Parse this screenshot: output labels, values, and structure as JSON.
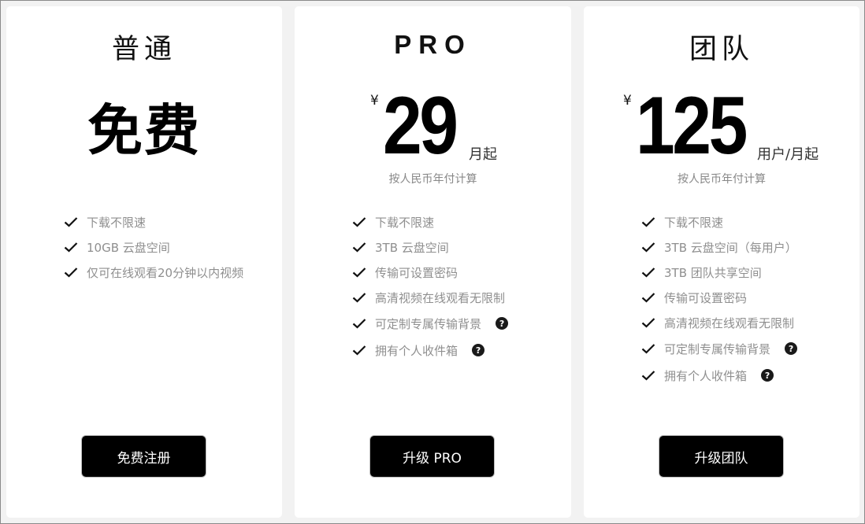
{
  "plans": [
    {
      "name": "普通",
      "price_text": "免费",
      "features": [
        "下载不限速",
        "10GB 云盘空间",
        "仅可在线观看20分钟以内视频"
      ],
      "cta_label": "免费注册"
    },
    {
      "name": "PRO",
      "currency": "¥",
      "amount": "29",
      "unit": "月起",
      "billing_note": "按人民币年付计算",
      "features": [
        "下载不限速",
        "3TB 云盘空间",
        "传输可设置密码",
        "高清视频在线观看无限制",
        "可定制专属传输背景",
        "拥有个人收件箱"
      ],
      "cta_label": "升级 PRO"
    },
    {
      "name": "团队",
      "currency": "¥",
      "amount": "125",
      "unit": "用户/月起",
      "billing_note": "按人民币年付计算",
      "features": [
        "下载不限速",
        "3TB 云盘空间（每用户）",
        "3TB 团队共享空间",
        "传输可设置密码",
        "高清视频在线观看无限制",
        "可定制专属传输背景",
        "拥有个人收件箱"
      ],
      "cta_label": "升级团队"
    }
  ],
  "icons": {
    "check": "check-icon",
    "help": "question-circle-icon",
    "help_glyph": "?"
  },
  "colors": {
    "button_bg": "#000000",
    "feature_text": "#8f8f8f",
    "page_bg": "#f2f2f2"
  }
}
